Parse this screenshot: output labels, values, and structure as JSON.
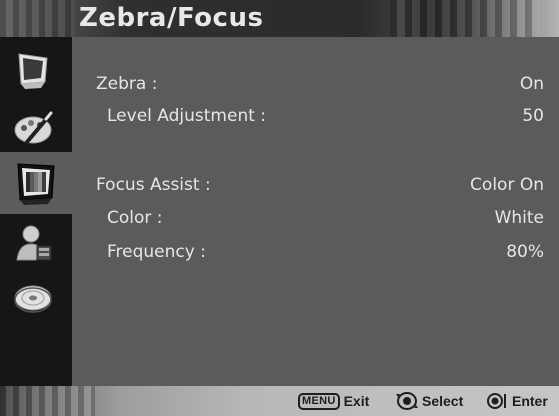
{
  "header": {
    "title": "Zebra/Focus"
  },
  "sidebar": {
    "items": [
      {
        "icon": "monitor-icon"
      },
      {
        "icon": "palette-icon"
      },
      {
        "icon": "color-monitor-icon",
        "active": true
      },
      {
        "icon": "user-settings-icon"
      },
      {
        "icon": "disc-icon"
      }
    ]
  },
  "settings": {
    "zebra": {
      "label": "Zebra :",
      "value": "On"
    },
    "level_adjustment": {
      "label": "Level Adjustment :",
      "value": "50"
    },
    "focus_assist": {
      "label": "Focus Assist :",
      "value": "Color On"
    },
    "color": {
      "label": "Color :",
      "value": "White"
    },
    "frequency": {
      "label": "Frequency :",
      "value": "80%"
    }
  },
  "footer": {
    "menu_key": "MENU",
    "exit_label": "Exit",
    "select_label": "Select",
    "enter_label": "Enter"
  }
}
